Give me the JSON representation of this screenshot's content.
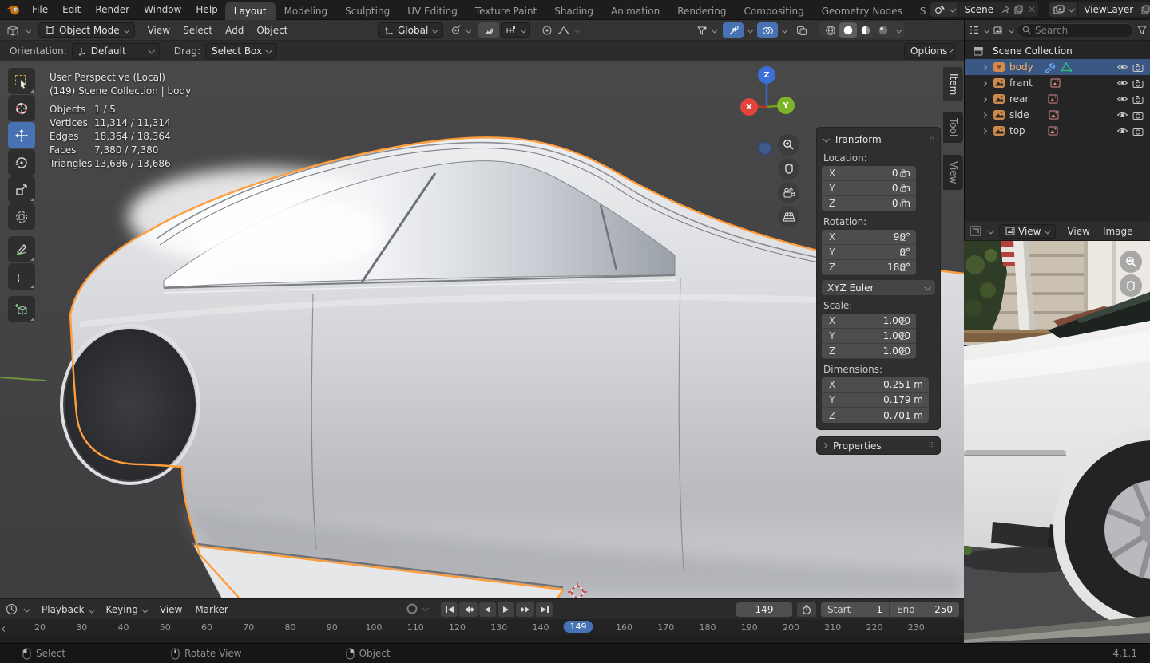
{
  "colors": {
    "accent": "#4772b3",
    "outline": "#ff9d3d",
    "active-text": "#ffb25c"
  },
  "topbar": {
    "menus": [
      "File",
      "Edit",
      "Render",
      "Window",
      "Help"
    ],
    "tabs": [
      "Layout",
      "Modeling",
      "Sculpting",
      "UV Editing",
      "Texture Paint",
      "Shading",
      "Animation",
      "Rendering",
      "Compositing",
      "Geometry Nodes",
      "S"
    ],
    "active_tab": "Layout",
    "scene_name": "Scene",
    "view_layer_name": "ViewLayer"
  },
  "viewport_header": {
    "mode": "Object Mode",
    "menus": [
      "View",
      "Select",
      "Add",
      "Object"
    ],
    "orientation": "Global"
  },
  "tool_settings": {
    "orientation_label": "Orientation:",
    "orientation_value": "Default",
    "drag_label": "Drag:",
    "drag_value": "Select Box",
    "options_label": "Options"
  },
  "overlay": {
    "line1": "User Perspective (Local)",
    "line2": "(149) Scene Collection | body",
    "stats": [
      {
        "label": "Objects",
        "value": "1 / 5"
      },
      {
        "label": "Vertices",
        "value": "11,314 / 11,314"
      },
      {
        "label": "Edges",
        "value": "18,364 / 18,364"
      },
      {
        "label": "Faces",
        "value": "7,380 / 7,380"
      },
      {
        "label": "Triangles",
        "value": "13,686 / 13,686"
      }
    ]
  },
  "gizmo": {
    "x": "X",
    "y": "Y",
    "z": "Z"
  },
  "sidebar": {
    "tabs": [
      "Item",
      "Tool",
      "View"
    ],
    "active_tab": "Item",
    "transform_title": "Transform",
    "location": {
      "label": "Location:",
      "rows": [
        [
          "X",
          "0 m"
        ],
        [
          "Y",
          "0 m"
        ],
        [
          "Z",
          "0 m"
        ]
      ]
    },
    "rotation": {
      "label": "Rotation:",
      "rows": [
        [
          "X",
          "90°"
        ],
        [
          "Y",
          "0°"
        ],
        [
          "Z",
          "180°"
        ]
      ],
      "mode": "XYZ Euler"
    },
    "scale": {
      "label": "Scale:",
      "rows": [
        [
          "X",
          "1.000"
        ],
        [
          "Y",
          "1.000"
        ],
        [
          "Z",
          "1.000"
        ]
      ]
    },
    "dimensions": {
      "label": "Dimensions:",
      "rows": [
        [
          "X",
          "0.251 m"
        ],
        [
          "Y",
          "0.179 m"
        ],
        [
          "Z",
          "0.701 m"
        ]
      ]
    },
    "properties_label": "Properties"
  },
  "outliner": {
    "search_placeholder": "Search",
    "root": "Scene Collection",
    "items": [
      {
        "name": "body",
        "type": "mesh",
        "selected": true
      },
      {
        "name": "frant",
        "type": "image",
        "selected": false
      },
      {
        "name": "rear",
        "type": "image",
        "selected": false
      },
      {
        "name": "side",
        "type": "image",
        "selected": false
      },
      {
        "name": "top",
        "type": "image",
        "selected": false
      }
    ]
  },
  "image_editor": {
    "mode": "View",
    "menus": [
      "View",
      "Image"
    ]
  },
  "timeline": {
    "menus": [
      "Playback",
      "Keying",
      "View",
      "Marker"
    ],
    "frame_field": "149",
    "current_frame": "149",
    "start_label": "Start",
    "start_value": "1",
    "end_label": "End",
    "end_value": "250",
    "ticks": [
      20,
      30,
      40,
      50,
      60,
      70,
      80,
      90,
      100,
      110,
      120,
      130,
      140,
      160,
      170,
      180,
      190,
      200,
      210,
      220,
      230
    ]
  },
  "statusbar": {
    "items": [
      {
        "label": "Select"
      },
      {
        "label": "Rotate View"
      },
      {
        "label": "Object"
      }
    ],
    "version": "4.1.1"
  }
}
